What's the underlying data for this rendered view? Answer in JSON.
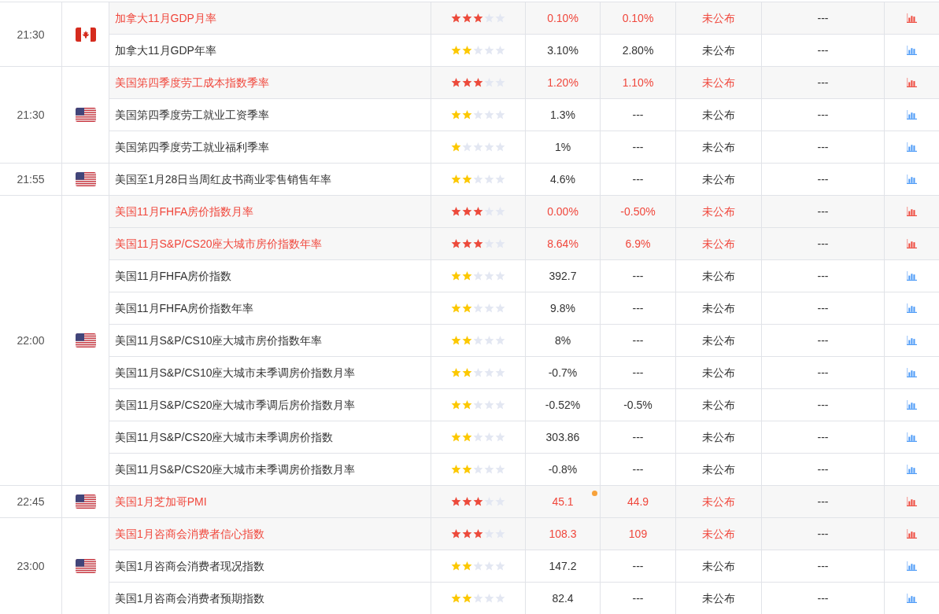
{
  "groups": [
    {
      "time": "21:30",
      "kind": "canada",
      "events": [
        {
          "name": "加拿大11月GDP月率",
          "important": true,
          "marked": false,
          "stars": 3,
          "column_5": "0.10%",
          "column_6": "0.10%",
          "column_7": "未公布",
          "column_8": "---"
        },
        {
          "name": "加拿大11月GDP年率",
          "important": false,
          "marked": false,
          "stars": 2,
          "column_5": "3.10%",
          "column_6": "2.80%",
          "column_7": "未公布",
          "column_8": "---"
        }
      ]
    },
    {
      "time": "21:30",
      "kind": "usa",
      "events": [
        {
          "name": "美国第四季度劳工成本指数季率",
          "important": true,
          "marked": false,
          "stars": 3,
          "column_5": "1.20%",
          "column_6": "1.10%",
          "column_7": "未公布",
          "column_8": "---"
        },
        {
          "name": "美国第四季度劳工就业工资季率",
          "important": false,
          "marked": false,
          "stars": 2,
          "column_5": "1.3%",
          "column_6": "---",
          "column_7": "未公布",
          "column_8": "---"
        },
        {
          "name": "美国第四季度劳工就业福利季率",
          "important": false,
          "marked": false,
          "stars": 1,
          "column_5": "1%",
          "column_6": "---",
          "column_7": "未公布",
          "column_8": "---"
        }
      ]
    },
    {
      "time": "21:55",
      "kind": "usa",
      "events": [
        {
          "name": "美国至1月28日当周红皮书商业零售销售年率",
          "important": false,
          "marked": false,
          "stars": 2,
          "column_5": "4.6%",
          "column_6": "---",
          "column_7": "未公布",
          "column_8": "---"
        }
      ]
    },
    {
      "time": "22:00",
      "kind": "usa",
      "events": [
        {
          "name": "美国11月FHFA房价指数月率",
          "important": true,
          "marked": false,
          "stars": 3,
          "column_5": "0.00%",
          "column_6": "-0.50%",
          "column_7": "未公布",
          "column_8": "---"
        },
        {
          "name": "美国11月S&P/CS20座大城市房价指数年率",
          "important": true,
          "marked": false,
          "stars": 3,
          "column_5": "8.64%",
          "column_6": "6.9%",
          "column_7": "未公布",
          "column_8": "---"
        },
        {
          "name": "美国11月FHFA房价指数",
          "important": false,
          "marked": false,
          "stars": 2,
          "column_5": "392.7",
          "column_6": "---",
          "column_7": "未公布",
          "column_8": "---"
        },
        {
          "name": "美国11月FHFA房价指数年率",
          "important": false,
          "marked": false,
          "stars": 2,
          "column_5": "9.8%",
          "column_6": "---",
          "column_7": "未公布",
          "column_8": "---"
        },
        {
          "name": "美国11月S&P/CS10座大城市房价指数年率",
          "important": false,
          "marked": false,
          "stars": 2,
          "column_5": "8%",
          "column_6": "---",
          "column_7": "未公布",
          "column_8": "---"
        },
        {
          "name": "美国11月S&P/CS10座大城市未季调房价指数月率",
          "important": false,
          "marked": false,
          "stars": 2,
          "column_5": "-0.7%",
          "column_6": "---",
          "column_7": "未公布",
          "column_8": "---"
        },
        {
          "name": "美国11月S&P/CS20座大城市季调后房价指数月率",
          "important": false,
          "marked": false,
          "stars": 2,
          "column_5": "-0.52%",
          "column_6": "-0.5%",
          "column_7": "未公布",
          "column_8": "---"
        },
        {
          "name": "美国11月S&P/CS20座大城市未季调房价指数",
          "important": false,
          "marked": false,
          "stars": 2,
          "column_5": "303.86",
          "column_6": "---",
          "column_7": "未公布",
          "column_8": "---"
        },
        {
          "name": "美国11月S&P/CS20座大城市未季调房价指数月率",
          "important": false,
          "marked": false,
          "stars": 2,
          "column_5": "-0.8%",
          "column_6": "---",
          "column_7": "未公布",
          "column_8": "---"
        }
      ]
    },
    {
      "time": "22:45",
      "kind": "usa",
      "events": [
        {
          "name": "美国1月芝加哥PMI",
          "important": true,
          "marked": true,
          "stars": 3,
          "column_5": "45.1",
          "column_6": "44.9",
          "column_7": "未公布",
          "column_8": "---"
        }
      ]
    },
    {
      "time": "23:00",
      "kind": "usa",
      "events": [
        {
          "name": "美国1月咨商会消费者信心指数",
          "important": true,
          "marked": false,
          "stars": 3,
          "column_5": "108.3",
          "column_6": "109",
          "column_7": "未公布",
          "column_8": "---"
        },
        {
          "name": "美国1月咨商会消费者现况指数",
          "important": false,
          "marked": false,
          "stars": 2,
          "column_5": "147.2",
          "column_6": "---",
          "column_7": "未公布",
          "column_8": "---"
        },
        {
          "name": "美国1月咨商会消费者预期指数",
          "important": false,
          "marked": false,
          "stars": 2,
          "column_5": "82.4",
          "column_6": "---",
          "column_7": "未公布",
          "column_8": "---"
        }
      ]
    }
  ]
}
